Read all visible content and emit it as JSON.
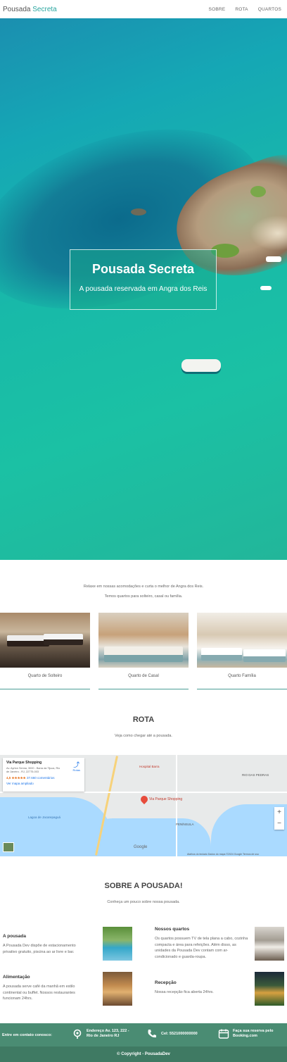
{
  "header": {
    "brand_first": "Pousada",
    "brand_second": "Secreta",
    "nav": [
      "SOBRE",
      "ROTA",
      "QUARTOS"
    ]
  },
  "hero": {
    "title": "Pousada Secreta",
    "subtitle": "A pousada reservada em Angra dos Reis"
  },
  "intro": {
    "line1": "Relaxe em nossas acomodações e curta o melhor de Angra dos Reis.",
    "line2": "Temos quartos para solteiro, casal ou família."
  },
  "rooms": [
    {
      "label": "Quarto de Solteiro"
    },
    {
      "label": "Quarto de Casal"
    },
    {
      "label": "Quarto Família"
    }
  ],
  "rota": {
    "title": "ROTA",
    "subtitle": "Veja como chegar até a pousada.",
    "map": {
      "place_name": "Via Parque Shopping",
      "address": "Av. Ayrton Senna, 3000 - Barra da Tijuca, Rio de Janeiro - RJ, 22775-003",
      "rating": "4,5 ★★★★★",
      "reviews": "37.660 comentários",
      "larger_map": "Ver mapa ampliado",
      "directions": "Rotas",
      "pin_label": "Via Parque Shopping",
      "labels": [
        "Via Parque Shopping",
        "Hospital Barra",
        "PENÍNSULA",
        "RIO DAS PEDRAS",
        "Lagoa de Jacarepaguá"
      ],
      "zoom_in": "+",
      "zoom_out": "−",
      "footer": "Atalhos do teclado   Dados do mapa ©2024 Google   Termos de uso",
      "google": "Google"
    }
  },
  "sobre": {
    "title": "SOBRE A POUSADA!",
    "subtitle": "Conheça um pouco sobre nossa pousada.",
    "features": [
      {
        "title": "A pousada",
        "text": "A Pousada Dev dispõe de estacionamento privativo gratuito, piscina ao ar livre e bar."
      },
      {
        "title": "Nossos quartos",
        "text": "Os quartos possuem TV de tela plana a cabo, cozinha compacta e área para refeições. Além disso, as unidades da Pousada Dev contam com ar-condicionado e guarda-roupa."
      },
      {
        "title": "Alimentação",
        "text": "A pousada serve café da manhã em estilo continental ou buffet. Nossos restaurantes funcionam 24hrs."
      },
      {
        "title": "Recepção",
        "text": "Nossa recepção fica aberta 24hrs."
      }
    ]
  },
  "footer": {
    "contact_label": "Entre em contato conosco:",
    "address": "Endereço Av. 123, 222 - Rio de Janeiro RJ",
    "phone": "Cel: 5521000000000",
    "booking": "Faça sua reserva pelo Booking.com",
    "copyright": "© Copyright - PousadaDev"
  },
  "colors": {
    "accent": "#2aa6a0",
    "footer_bg": "#4a8c73",
    "footer_bottom": "#3f7a63"
  }
}
